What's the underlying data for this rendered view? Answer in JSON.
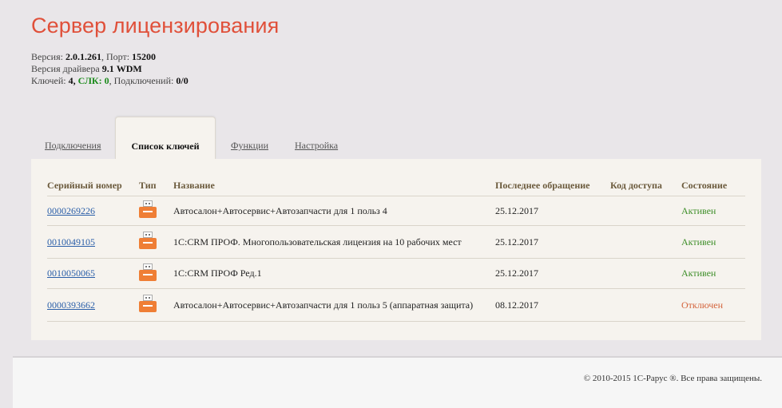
{
  "header": {
    "title": "Сервер лицензирования",
    "version_label": "Версия:",
    "version": "2.0.1.261",
    "port_label": "Порт:",
    "port": "15200",
    "driver_label": "Версия драйвера",
    "driver": "9.1 WDM",
    "keys_label": "Ключей:",
    "keys": "4",
    "slk_label": "СЛК:",
    "slk": "0",
    "connections_label": "Подключений:",
    "connections": "0/0"
  },
  "tabs": [
    {
      "label": "Подключения",
      "active": false
    },
    {
      "label": "Список ключей",
      "active": true
    },
    {
      "label": "Функции",
      "active": false
    },
    {
      "label": "Настройка",
      "active": false
    }
  ],
  "table": {
    "columns": [
      "Серийный номер",
      "Тип",
      "Название",
      "Последнее обращение",
      "Код доступа",
      "Состояние"
    ],
    "rows": [
      {
        "serial": "0000269226",
        "type_icon": "usb-key-icon",
        "name": "Автосалон+Автосервис+Автозапчасти для 1 польз 4",
        "last_access": "25.12.2017",
        "access_code": "",
        "status": "Активен"
      },
      {
        "serial": "0010049105",
        "type_icon": "usb-key-icon",
        "name": "1С:CRM ПРОФ. Многопользовательская лицензия на 10 рабочих мест",
        "last_access": "25.12.2017",
        "access_code": "",
        "status": "Активен"
      },
      {
        "serial": "0010050065",
        "type_icon": "usb-key-icon",
        "name": "1С:CRM ПРОФ Ред.1",
        "last_access": "25.12.2017",
        "access_code": "",
        "status": "Активен"
      },
      {
        "serial": "0000393662",
        "type_icon": "usb-key-icon",
        "name": "Автосалон+Автосервис+Автозапчасти для 1 польз 5 (аппаратная защита)",
        "last_access": "08.12.2017",
        "access_code": "",
        "status": "Отключен"
      }
    ]
  },
  "footer": {
    "copyright": "© 2010-2015 1С-Рарус ®. Все права защищены."
  },
  "colors": {
    "title": "#e0503a",
    "status_active": "#3f8f2a",
    "status_off": "#d4643c",
    "slk": "#1a8a1a",
    "usb_icon": "#ef7e35"
  }
}
